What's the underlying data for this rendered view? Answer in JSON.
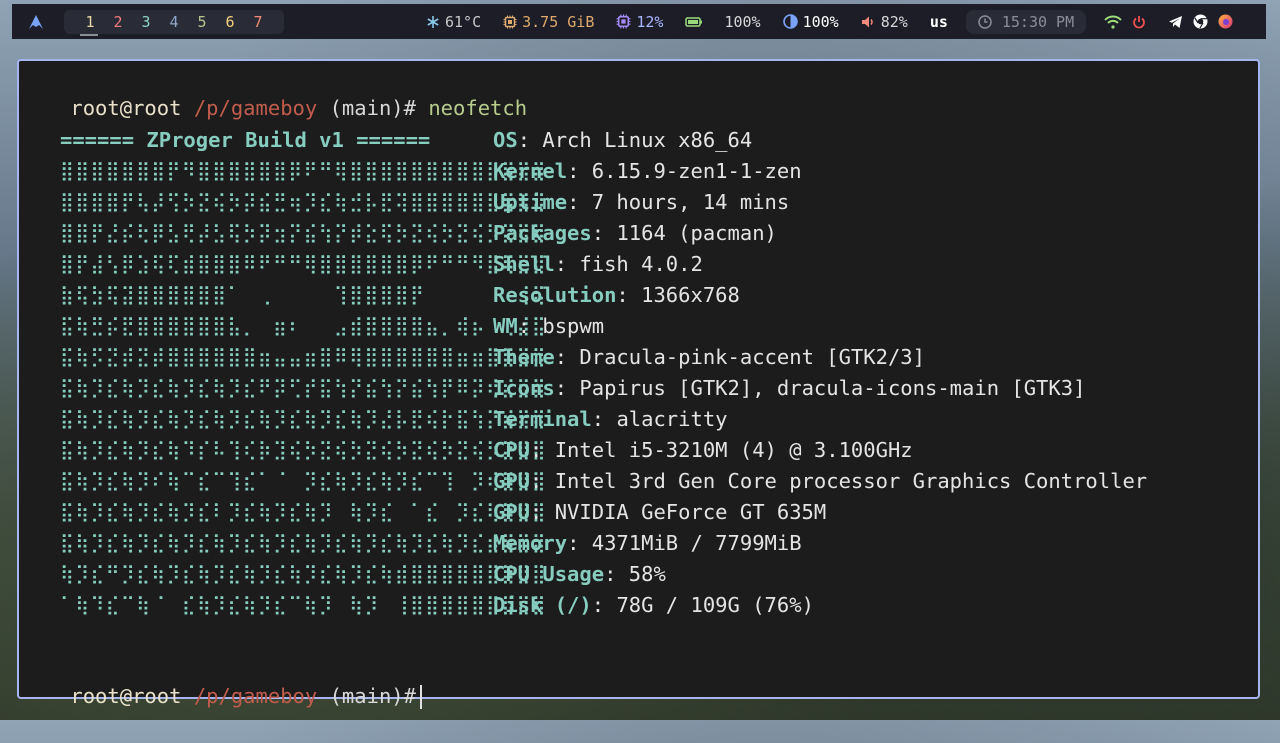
{
  "topbar": {
    "logo_icon": "arch-icon",
    "workspaces": [
      {
        "label": "1",
        "color": "#e8d7a6",
        "active": true
      },
      {
        "label": "2",
        "color": "#f27b7b"
      },
      {
        "label": "3",
        "color": "#8ed4c6"
      },
      {
        "label": "4",
        "color": "#8fa8c7"
      },
      {
        "label": "5",
        "color": "#b9c48f"
      },
      {
        "label": "6",
        "color": "#f4d27a"
      },
      {
        "label": "7",
        "color": "#f38a7a"
      }
    ],
    "stats": [
      {
        "icon": "snowflake-icon",
        "glyph": "❄",
        "value": "61°C",
        "color": "#89c7e8",
        "text_color": "#c8c8c8"
      },
      {
        "icon": "memory-icon",
        "glyph": "⚙",
        "value": "3.75 GiB",
        "color": "#e0a96d",
        "text_color": "#e0a96d"
      },
      {
        "icon": "cpu-icon",
        "glyph": "⚙",
        "value": "12%",
        "color": "#a78bfa",
        "text_color": "#a8b6ff"
      },
      {
        "icon": "battery-icon",
        "glyph": "▬",
        "value": "100%",
        "color": "#9bdb7c",
        "text_color": "#d8d8d8"
      },
      {
        "icon": "brightness-icon",
        "glyph": "◐",
        "value": "100%",
        "color": "#7aa2f7",
        "text_color": "#ffffff"
      },
      {
        "icon": "volume-icon",
        "glyph": "🔈",
        "value": "82%",
        "color": "#f38a7a",
        "text_color": "#d8d8d8"
      },
      {
        "icon": "keyboard-layout-icon",
        "glyph": "",
        "value": "us",
        "color": "#ffffff",
        "text_color": "#ffffff"
      }
    ],
    "clock": {
      "icon": "clock-icon",
      "value": "15:30 PM"
    },
    "tray": [
      {
        "icon": "wifi-icon",
        "color": "#9bdb7c"
      },
      {
        "icon": "power-icon",
        "color": "#f05050"
      },
      {
        "icon": "telegram-icon",
        "color": "#ffffff"
      },
      {
        "icon": "chrome-icon",
        "color": "#ffffff"
      },
      {
        "icon": "firefox-icon",
        "color": "#e64a8a"
      }
    ]
  },
  "terminal": {
    "prompt": {
      "user": "root",
      "at": "@",
      "host": "root",
      "path": "/p/gameboy",
      "branch": "(main)",
      "symbol": "#"
    },
    "command": "neofetch",
    "ascii_header": "====== ZProger Build v1 ======",
    "ascii_art": [
      "⣿⣿⣿⣿⣿⣿⣿⡟⠻⣿⣿⣿⣿⣿⣿⡿⠟⠛⢿⣿⣿⣿⣿⣿⣿⣿⣿⣿⣿⣿⣿⣿",
      "⣿⣿⣿⣿⡟⢧⡼⢫⡳⣝⢮⡳⡽⣮⣛⢶⡹⣎⢷⣚⡧⣟⢽⣿⣿⣿⣿⣿⣿⣿⣿⣿",
      "⣿⣿⡟⣜⡮⢗⡿⣣⢟⡼⣣⢯⡳⡽⣲⡝⣮⢳⡝⡾⣕⢯⡳⣝⢮⡳⣝⢮⡳⣝⣿⣿",
      "⣿⡟⣼⢣⡿⣱⢯⢏⣾⣿⣿⣿⠿⠟⠛⠛⢿⣿⣿⣿⣿⣿⣿⡿⠟⠛⠛⠻⣿⢯⣛⣾",
      "⣷⢯⣳⢯⣽⣿⣿⣿⣿⣿⣿⠁⠀⢀⠀⠀⠀⠀⢹⣿⣿⣿⣿⡟⠀⠀⠀⠀⠀⠀⢸⢯",
      "⣯⢷⣛⡮⣟⣿⣿⣿⣿⣿⣿⣧⡀⠀⣶⠆⠀⠀⣠⣾⣿⣿⣿⣿⣦⡀⢾⡦⠀⢀⣼⣯",
      "⣯⢷⡫⣝⡾⣝⡾⣿⣿⣿⣿⣿⣿⣶⣤⣤⣶⣿⠿⢿⣿⣿⣿⣿⣿⣿⣶⣶⣿⣿⣽⣿",
      "⣯⢷⡹⣎⢷⡹⣎⢷⡹⣎⢷⡹⣎⠟⡽⢋⡞⣯⢳⡝⣮⢳⡝⣮⢳⡟⠿⡽⢞⣞⣿⣿",
      "⣯⢷⡹⣎⢷⡹⣎⢷⡹⣎⢷⡹⣎⢷⡹⣎⢷⡹⣎⢷⡹⣜⡧⣟⢮⡗⣯⢳⡝⣾⣿⣿",
      "⣯⢷⡹⣎⢷⡹⣎⢷⠹⡎⠧⢹⢎⡷⣹⢮⡳⣝⢮⡳⣝⢮⡳⣝⢮⡳⣝⢮⡳⣝⣿⣿",
      "⣯⢷⡹⣎⢷⡹⠎⢷⠉⣎⠉⢹⣎⠁⠈⠀⡹⣎⢷⡹⣎⢷⡹⣎⠉⢹⠀⡹⢎⣿⣿⣿",
      "⣯⢷⡹⣎⢷⡹⣎⢷⡹⣎⠇⡹⣎⢷⡹⣎⢷⡹⠀⢷⡹⣎⠀⠁⣎⠀⡹⣎⢷⣿⣿⣿",
      "⣯⢷⡹⣎⢷⡹⣎⢷⡹⣎⢷⡹⣎⢷⡹⣎⢷⡹⣎⢷⡹⣎⢷⡹⣎⢷⡹⣎⣾⣿⣿⣿",
      "⢷⡹⣎⠛⡹⣎⢷⡹⣎⢷⡹⣎⢷⡹⣎⢷⡹⣎⢷⡹⣎⢷⣾⣿⣿⣿⣿⣿⣿⣿⣿⣿",
      "⠁⢷⠹⣎⠉⢷⠈⠀⣎⢷⡹⣎⢷⡹⣎⠉⢷⡹⠀⢷⡹⠀⢸⣿⣿⣿⣿⣿⣿⣿⣿⣿"
    ],
    "info": [
      {
        "key": "OS",
        "value": "Arch Linux x86_64"
      },
      {
        "key": "Kernel",
        "value": "6.15.9-zen1-1-zen"
      },
      {
        "key": "Uptime",
        "value": "7 hours, 14 mins"
      },
      {
        "key": "Packages",
        "value": "1164 (pacman)"
      },
      {
        "key": "Shell",
        "value": "fish 4.0.2"
      },
      {
        "key": "Resolution",
        "value": "1366x768"
      },
      {
        "key": "WM",
        "value": "bspwm"
      },
      {
        "key": "Theme",
        "value": "Dracula-pink-accent [GTK2/3]"
      },
      {
        "key": "Icons",
        "value": "Papirus [GTK2], dracula-icons-main [GTK3]"
      },
      {
        "key": "Terminal",
        "value": "alacritty"
      },
      {
        "key": "CPU",
        "value": "Intel i5-3210M (4) @ 3.100GHz"
      },
      {
        "key": "GPU",
        "value": "Intel 3rd Gen Core processor Graphics Controller"
      },
      {
        "key": "GPU",
        "value": "NVIDIA GeForce GT 635M"
      },
      {
        "key": "Memory",
        "value": "4371MiB / 7799MiB"
      },
      {
        "key": "CPU Usage",
        "value": "58%"
      },
      {
        "key": "Disk (/)",
        "value": "78G / 109G (76%)"
      }
    ],
    "key_separator": ":"
  }
}
